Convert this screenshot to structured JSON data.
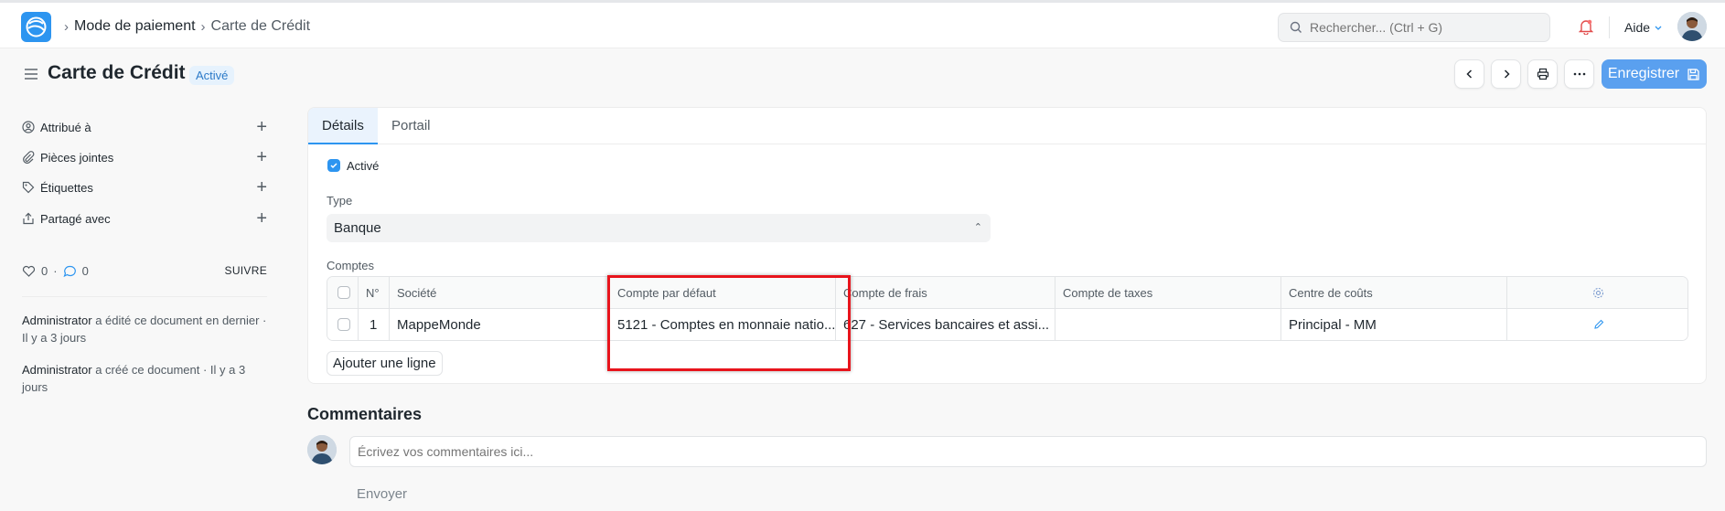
{
  "topbar": {
    "breadcrumbs": [
      "Mode de paiement",
      "Carte de Crédit"
    ],
    "search_placeholder": "Rechercher... (Ctrl + G)",
    "help_label": "Aide"
  },
  "page": {
    "title": "Carte de Crédit",
    "status": "Activé",
    "save_label": "Enregistrer"
  },
  "sidebar": {
    "items": [
      {
        "label": "Attribué à",
        "icon": "user-assign-icon"
      },
      {
        "label": "Pièces jointes",
        "icon": "paperclip-icon"
      },
      {
        "label": "Étiquettes",
        "icon": "tag-icon"
      },
      {
        "label": "Partagé avec",
        "icon": "share-icon"
      }
    ],
    "likes": "0",
    "comments": "0",
    "follow_label": "SUIVRE",
    "activity": [
      {
        "user": "Administrator",
        "text": " a édité ce document en dernier · Il y a 3 jours"
      },
      {
        "user": "Administrator",
        "text": " a créé ce document · Il y a 3 jours"
      }
    ]
  },
  "tabs": [
    "Détails",
    "Portail"
  ],
  "form": {
    "enabled_label": "Activé",
    "enabled": true,
    "type_label": "Type",
    "type_value": "Banque",
    "accounts_label": "Comptes",
    "table": {
      "columns": [
        "N°",
        "Société",
        "Compte par défaut",
        "Compte de frais",
        "Compte de taxes",
        "Centre de coûts"
      ],
      "rows": [
        {
          "no": "1",
          "company": "MappeMonde",
          "default_account": "5121 - Comptes en monnaie natio...",
          "fee_account": "627 - Services bancaires et assi...",
          "tax_account": "",
          "cost_center": "Principal - MM"
        }
      ]
    },
    "add_row_label": "Ajouter une ligne"
  },
  "comments": {
    "title": "Commentaires",
    "placeholder": "Écrivez vos commentaires ici...",
    "send_label": "Envoyer"
  },
  "colors": {
    "accent": "#2d95f0",
    "highlight": "#e8141c"
  }
}
